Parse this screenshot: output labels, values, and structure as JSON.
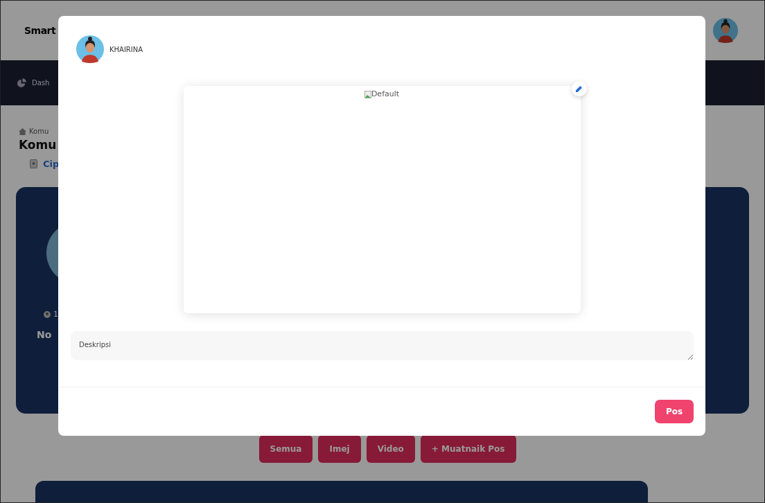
{
  "app": {
    "brand": "Smart",
    "nav_item": "Dash",
    "breadcrumb": "Komu",
    "page_title": "Komu",
    "link": "Cip"
  },
  "profile_card": {
    "stat": "1",
    "name": "No"
  },
  "filter_buttons": [
    {
      "label": "Semua"
    },
    {
      "label": "Imej"
    },
    {
      "label": "Video"
    },
    {
      "label": "+ Muatnaik Pos"
    }
  ],
  "modal": {
    "user": "KHAIRINA",
    "image_alt": "Default",
    "description": {
      "placeholder": "Deskripsi"
    },
    "submit": "Pos"
  }
}
